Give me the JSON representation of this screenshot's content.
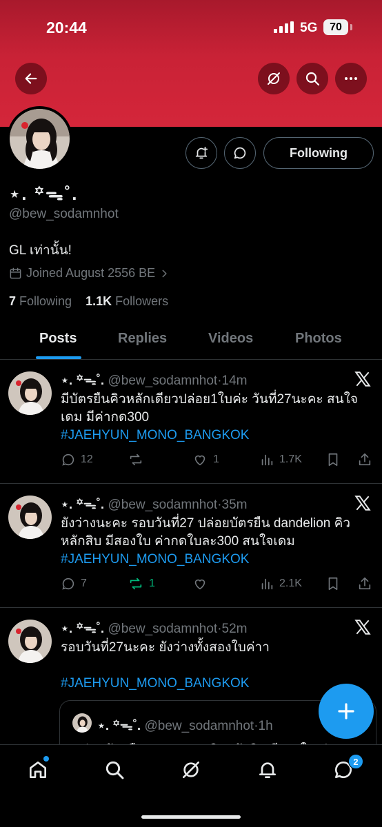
{
  "status_bar": {
    "time": "20:44",
    "network": "5G",
    "battery": "70"
  },
  "header": {
    "back_icon": "arrow-left-icon",
    "grok_icon": "grok-slash-icon",
    "search_icon": "search-icon",
    "more_icon": "more-horizontal-icon"
  },
  "profile": {
    "display_name": "⋆. ꙳ᯓ˚.",
    "handle": "@bew_sodamnhot",
    "bio": "GL เท่านั้น!",
    "joined": "Joined August 2556 BE",
    "following_count": "7",
    "following_label": "Following",
    "followers_count": "1.1K",
    "followers_label": "Followers",
    "follow_button_label": "Following"
  },
  "tabs": [
    {
      "label": "Posts",
      "active": true
    },
    {
      "label": "Replies",
      "active": false
    },
    {
      "label": "Videos",
      "active": false
    },
    {
      "label": "Photos",
      "active": false
    }
  ],
  "posts": [
    {
      "name": "⋆. ꙳ᯓ˚.",
      "handle": "@bew_sodamnhot",
      "time": "14m",
      "text": "มีบัตรยืนคิวหลักเดียวปล่อย1ใบค่ะ วันที่27นะคะ สนใจเดม มีค่ากด300",
      "hashtag": "#JAEHYUN_MONO_BANGKOK",
      "replies": "12",
      "reposts": "",
      "likes": "1",
      "views": "1.7K",
      "reposted": false
    },
    {
      "name": "⋆. ꙳ᯓ˚.",
      "handle": "@bew_sodamnhot",
      "time": "35m",
      "text": "ยังว่างนะคะ รอบวันที่27  ปล่อยบัตรยืน dandelion คิวหลักสิบ มีสองใบ ค่ากดใบละ300 สนใจเดม",
      "hashtag": "#JAEHYUN_MONO_BANGKOK",
      "replies": "7",
      "reposts": "1",
      "likes": "",
      "views": "2.1K",
      "reposted": true
    },
    {
      "name": "⋆. ꙳ᯓ˚.",
      "handle": "@bew_sodamnhot",
      "time": "52m",
      "text": "รอบวันที่27นะคะ ยังว่างทั้งสองใบค่าา",
      "hashtag": "#JAEHYUN_MONO_BANGKOK",
      "quote": {
        "name": "⋆. ꙳ᯓ˚.",
        "handle": "@bew_sodamnhot",
        "time": "1h",
        "text": "ปล่อยบัตรยืน dandelion คิวหลักสิบ มีสองใบ ค่า"
      }
    }
  ],
  "bottom_nav": {
    "messages_badge": "2"
  },
  "colors": {
    "accent": "#1d9bf0",
    "banner": "#c92236",
    "repost_active": "#00ba7c",
    "muted": "#71767b"
  }
}
